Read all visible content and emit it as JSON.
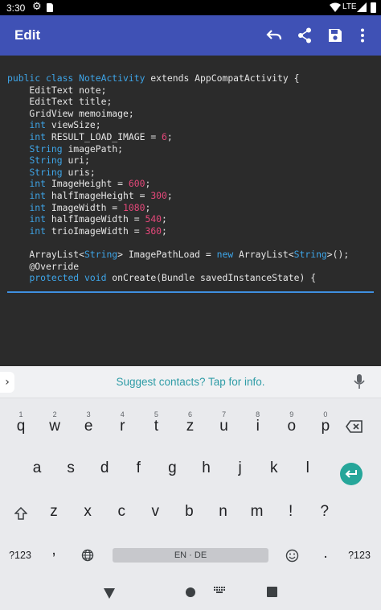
{
  "status_bar": {
    "time": "3:30",
    "network": "LTE",
    "icons": [
      "gear-icon",
      "sd-card-icon",
      "wifi-icon",
      "signal-icon",
      "battery-icon"
    ]
  },
  "app_bar": {
    "title": "Edit",
    "actions": [
      "undo-icon",
      "share-icon",
      "save-icon",
      "more-vert-icon"
    ],
    "color": "#3f51b5"
  },
  "editor": {
    "background": "#2b2b2b",
    "keyword_color": "#3ea5e8",
    "number_color": "#e5487a",
    "lines": [
      [
        {
          "t": "public class ",
          "k": "kw"
        },
        {
          "t": "NoteActivity",
          "k": "kw"
        },
        {
          "t": " extends AppCompatActivity {",
          "k": ""
        }
      ],
      [
        {
          "t": "    EditText note;",
          "k": ""
        }
      ],
      [
        {
          "t": "    EditText title;",
          "k": ""
        }
      ],
      [
        {
          "t": "    GridView memoimage;",
          "k": ""
        }
      ],
      [
        {
          "t": "    ",
          "k": ""
        },
        {
          "t": "int",
          "k": "kw"
        },
        {
          "t": " viewSize;",
          "k": ""
        }
      ],
      [
        {
          "t": "    ",
          "k": ""
        },
        {
          "t": "int",
          "k": "kw"
        },
        {
          "t": " RESULT_LOAD_IMAGE = ",
          "k": ""
        },
        {
          "t": "6",
          "k": "num"
        },
        {
          "t": ";",
          "k": ""
        }
      ],
      [
        {
          "t": "    ",
          "k": ""
        },
        {
          "t": "String",
          "k": "kw"
        },
        {
          "t": " imagePath;",
          "k": ""
        }
      ],
      [
        {
          "t": "    ",
          "k": ""
        },
        {
          "t": "String",
          "k": "kw"
        },
        {
          "t": " uri;",
          "k": ""
        }
      ],
      [
        {
          "t": "    ",
          "k": ""
        },
        {
          "t": "String",
          "k": "kw"
        },
        {
          "t": " uris;",
          "k": ""
        }
      ],
      [
        {
          "t": "    ",
          "k": ""
        },
        {
          "t": "int",
          "k": "kw"
        },
        {
          "t": " ImageHeight = ",
          "k": ""
        },
        {
          "t": "600",
          "k": "num"
        },
        {
          "t": ";",
          "k": ""
        }
      ],
      [
        {
          "t": "    ",
          "k": ""
        },
        {
          "t": "int",
          "k": "kw"
        },
        {
          "t": " halfImageHeight = ",
          "k": ""
        },
        {
          "t": "300",
          "k": "num"
        },
        {
          "t": ";",
          "k": ""
        }
      ],
      [
        {
          "t": "    ",
          "k": ""
        },
        {
          "t": "int",
          "k": "kw"
        },
        {
          "t": " ImageWidth = ",
          "k": ""
        },
        {
          "t": "1080",
          "k": "num"
        },
        {
          "t": ";",
          "k": ""
        }
      ],
      [
        {
          "t": "    ",
          "k": ""
        },
        {
          "t": "int",
          "k": "kw"
        },
        {
          "t": " halfImageWidth = ",
          "k": ""
        },
        {
          "t": "540",
          "k": "num"
        },
        {
          "t": ";",
          "k": ""
        }
      ],
      [
        {
          "t": "    ",
          "k": ""
        },
        {
          "t": "int",
          "k": "kw"
        },
        {
          "t": " trioImageWidth = ",
          "k": ""
        },
        {
          "t": "360",
          "k": "num"
        },
        {
          "t": ";",
          "k": ""
        }
      ],
      [
        {
          "t": "",
          "k": ""
        }
      ],
      [
        {
          "t": "    ArrayList<",
          "k": ""
        },
        {
          "t": "String",
          "k": "kw"
        },
        {
          "t": "> ImagePathLoad = ",
          "k": ""
        },
        {
          "t": "new",
          "k": "kw"
        },
        {
          "t": " ArrayList<",
          "k": ""
        },
        {
          "t": "String",
          "k": "kw"
        },
        {
          "t": ">();",
          "k": ""
        }
      ],
      [
        {
          "t": "    @Override",
          "k": ""
        }
      ],
      [
        {
          "t": "    ",
          "k": ""
        },
        {
          "t": "protected void",
          "k": "kw"
        },
        {
          "t": " onCreate(Bundle savedInstanceState) {",
          "k": ""
        }
      ]
    ]
  },
  "keyboard": {
    "suggestion": "Suggest contacts? Tap for info.",
    "suggestion_color": "#2e9ca6",
    "row1": [
      {
        "key": "q",
        "hint": "1"
      },
      {
        "key": "w",
        "hint": "2"
      },
      {
        "key": "e",
        "hint": "3"
      },
      {
        "key": "r",
        "hint": "4"
      },
      {
        "key": "t",
        "hint": "5"
      },
      {
        "key": "z",
        "hint": "6"
      },
      {
        "key": "u",
        "hint": "7"
      },
      {
        "key": "i",
        "hint": "8"
      },
      {
        "key": "o",
        "hint": "9"
      },
      {
        "key": "p",
        "hint": "0"
      }
    ],
    "row2": [
      "a",
      "s",
      "d",
      "f",
      "g",
      "h",
      "j",
      "k",
      "l"
    ],
    "row3": [
      "z",
      "x",
      "c",
      "v",
      "b",
      "n",
      "m",
      "!",
      "?"
    ],
    "symbols_key": "?123",
    "comma_key": ",",
    "space_label": "EN · DE",
    "period_key": ".",
    "symbols_key_right": "?123",
    "enter_color": "#26a69a"
  },
  "nav_bar": {
    "icons": [
      "back-icon",
      "home-icon",
      "keyboard-switch-icon",
      "recents-icon"
    ]
  }
}
